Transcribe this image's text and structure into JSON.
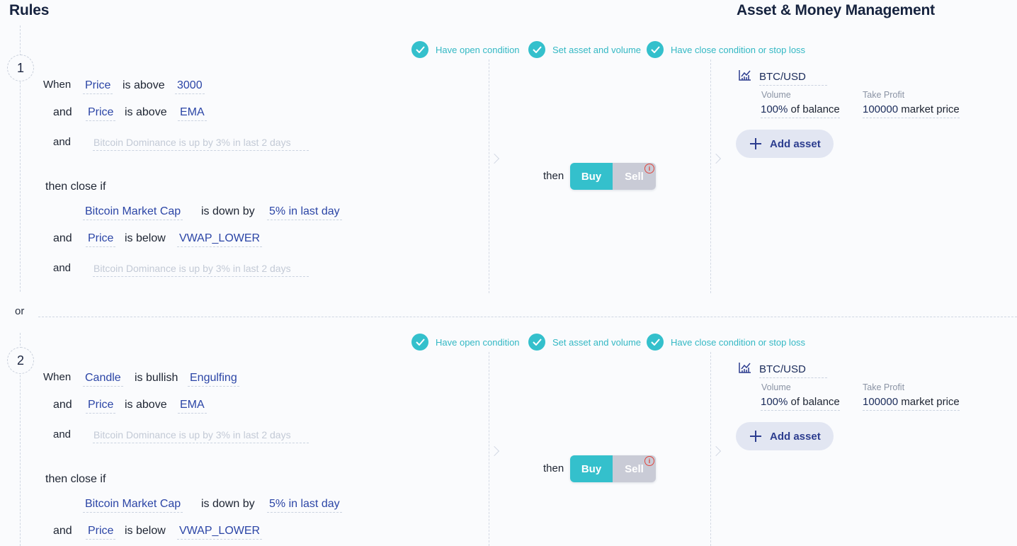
{
  "header": {
    "rules_title": "Rules",
    "asset_title": "Asset & Money Management"
  },
  "checks": [
    "Have open condition",
    "Set asset and volume",
    "Have close condition or stop loss"
  ],
  "or_label": "or",
  "rules": [
    {
      "number": "1",
      "open": {
        "when": "When",
        "c1": {
          "subject": "Price",
          "op": "is above",
          "value": "3000"
        },
        "and1": "and",
        "c2": {
          "subject": "Price",
          "op": "is above",
          "value": "EMA"
        },
        "and2": "and",
        "placeholder": "Bitcoin Dominance is up by 3% in last 2 days"
      },
      "close": {
        "label": "then close if",
        "c1": {
          "subject": "Bitcoin Market Cap",
          "op": "is down by",
          "value": "5% in last day"
        },
        "and1": "and",
        "c2": {
          "subject": "Price",
          "op": "is below",
          "value": "VWAP_LOWER"
        },
        "and2": "and",
        "placeholder": "Bitcoin Dominance is up by 3% in last 2 days"
      },
      "action": {
        "then": "then",
        "buy": "Buy",
        "sell": "Sell",
        "info": "i"
      },
      "asset": {
        "name": "BTC/USD",
        "volume_label": "Volume",
        "volume_value": "100%",
        "volume_suffix": "of balance",
        "tp_label": "Take Profit",
        "tp_value": "100000",
        "tp_suffix": "market price",
        "add_label": "Add asset"
      }
    },
    {
      "number": "2",
      "open": {
        "when": "When",
        "c1": {
          "subject": "Candle",
          "op": "is bullish",
          "value": "Engulfing"
        },
        "and1": "and",
        "c2": {
          "subject": "Price",
          "op": "is above",
          "value": "EMA"
        },
        "and2": "and",
        "placeholder": "Bitcoin Dominance is up by 3% in last 2 days"
      },
      "close": {
        "label": "then close if",
        "c1": {
          "subject": "Bitcoin Market Cap",
          "op": "is down by",
          "value": "5% in last day"
        },
        "and1": "and",
        "c2": {
          "subject": "Price",
          "op": "is below",
          "value": "VWAP_LOWER"
        }
      },
      "action": {
        "then": "then",
        "buy": "Buy",
        "sell": "Sell",
        "info": "i"
      },
      "asset": {
        "name": "BTC/USD",
        "volume_label": "Volume",
        "volume_value": "100%",
        "volume_suffix": "of balance",
        "tp_label": "Take Profit",
        "tp_value": "100000",
        "tp_suffix": "market price",
        "add_label": "Add asset"
      }
    }
  ],
  "colors": {
    "accent": "#34c0cc",
    "link": "#2b45a6",
    "sell": "#c9cbd6",
    "info": "#e0443c"
  }
}
